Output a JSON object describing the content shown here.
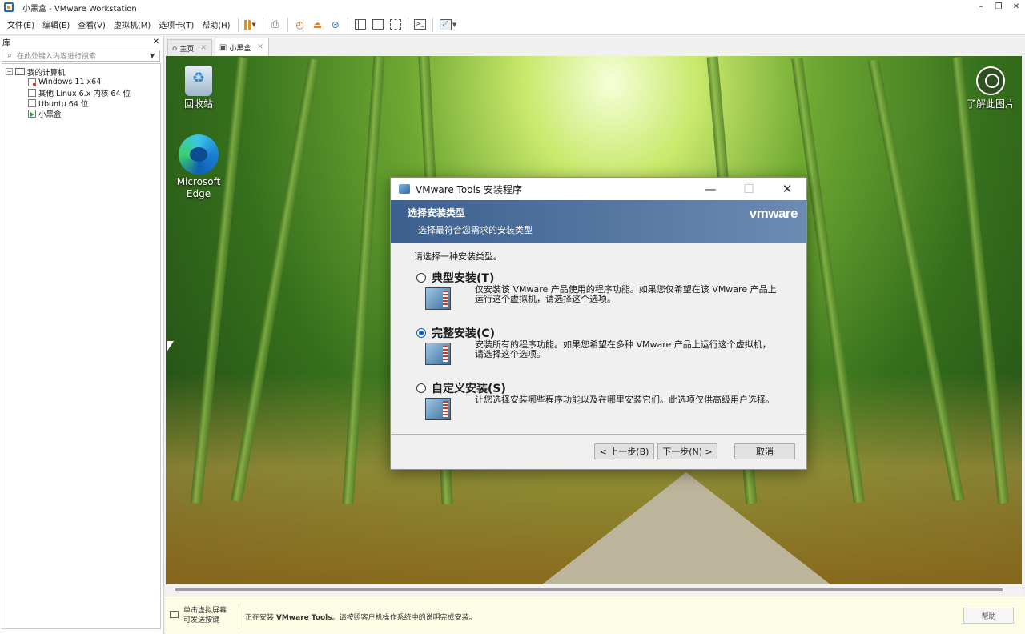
{
  "window": {
    "title": "小黑盒 - VMware Workstation",
    "controls": [
      "–",
      "❐",
      "✕"
    ]
  },
  "menu": [
    "文件(E)",
    "编辑(E)",
    "查看(V)",
    "虚拟机(M)",
    "选项卡(T)",
    "帮助(H)"
  ],
  "library": {
    "title": "库",
    "close": "✕",
    "search_placeholder": "在此处键入内容进行搜索",
    "root": "我的计算机",
    "vms": [
      "Windows 11 x64",
      "其他 Linux 6.x 内核 64 位",
      "Ubuntu 64 位",
      "小黑盒"
    ]
  },
  "tabs": [
    {
      "label": "主页",
      "icon": "home-icon"
    },
    {
      "label": "小黑盒",
      "icon": "vm-icon",
      "active": true
    }
  ],
  "desktop": {
    "recycle_bin": "回收站",
    "edge": "Microsoft Edge",
    "learn_picture": "了解此图片"
  },
  "dialog": {
    "title": "VMware Tools 安装程序",
    "banner_title": "选择安装类型",
    "banner_sub": "选择最符合您需求的安装类型",
    "logo": "vmware",
    "prompt": "请选择一种安装类型。",
    "options": [
      {
        "label": "典型安装(T)",
        "desc": "仅安装该 VMware 产品使用的程序功能。如果您仅希望在该 VMware 产品上运行这个虚拟机，请选择这个选项。",
        "checked": false
      },
      {
        "label": "完整安装(C)",
        "desc": "安装所有的程序功能。如果您希望在多种 VMware 产品上运行这个虚拟机，请选择这个选项。",
        "checked": true
      },
      {
        "label": "自定义安装(S)",
        "desc": "让您选择安装哪些程序功能以及在哪里安装它们。此选项仅供高级用户选择。",
        "checked": false
      }
    ],
    "back": "< 上一步(B)",
    "next": "下一步(N) >",
    "cancel": "取消"
  },
  "statusbar": {
    "hint_line1": "单击虚拟屏幕",
    "hint_line2": "可发送按键",
    "msg_prefix": "正在安装",
    "msg_bold": "VMware Tools",
    "msg_suffix": "。请按照客户机操作系统中的说明完成安装。",
    "help": "帮助"
  }
}
